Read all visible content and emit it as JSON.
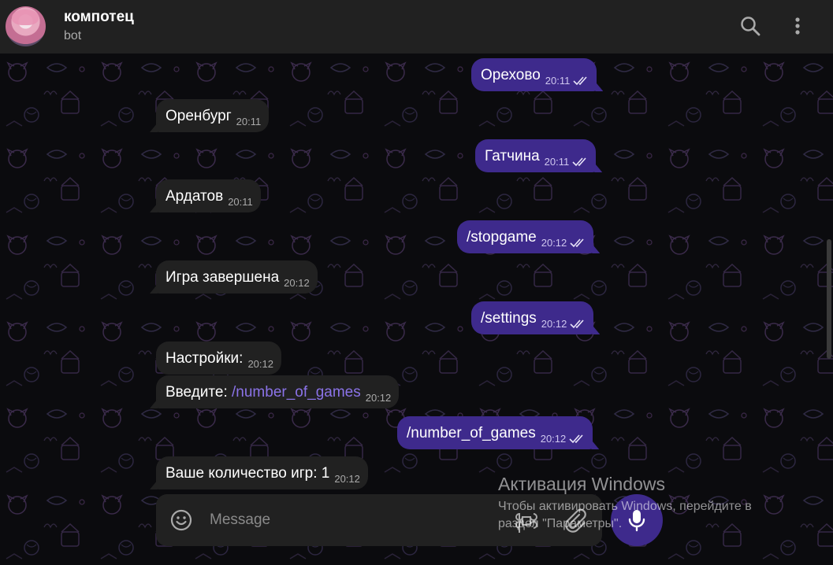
{
  "header": {
    "title": "компотец",
    "subtitle": "bot"
  },
  "messages": [
    {
      "dir": "out",
      "text": "Орехово",
      "time": "20:11"
    },
    {
      "dir": "in",
      "text": "Оренбург",
      "time": "20:11"
    },
    {
      "dir": "out",
      "text": "Гатчина",
      "time": "20:11"
    },
    {
      "dir": "in",
      "text": "Ардатов",
      "time": "20:11"
    },
    {
      "dir": "out",
      "text": "/stopgame",
      "time": "20:12"
    },
    {
      "dir": "in",
      "text": "Игра завершена",
      "time": "20:12"
    },
    {
      "dir": "out",
      "text": "/settings",
      "time": "20:12"
    },
    {
      "dir": "in",
      "text": "Настройки:",
      "time": "20:12"
    },
    {
      "dir": "in",
      "text_prefix": "Введите: ",
      "command": "/number_of_games",
      "time": "20:12"
    },
    {
      "dir": "out",
      "text": "/number_of_games",
      "time": "20:12"
    },
    {
      "dir": "in",
      "text": "Ваше количество игр: 1",
      "time": "20:12"
    }
  ],
  "composer": {
    "placeholder": "Message"
  },
  "watermark": {
    "title": "Активация Windows",
    "text": "Чтобы активировать Windows, перейдите в раздел \"Параметры\"."
  },
  "colors": {
    "outgoing_bubble": "#3e2a8c",
    "incoming_bubble": "#212121",
    "header": "#212121",
    "command_link": "#8b73e8"
  },
  "icons": [
    "search-icon",
    "more-icon",
    "emoji-icon",
    "command-icon",
    "attach-icon",
    "microphone-icon",
    "double-check-icon"
  ]
}
